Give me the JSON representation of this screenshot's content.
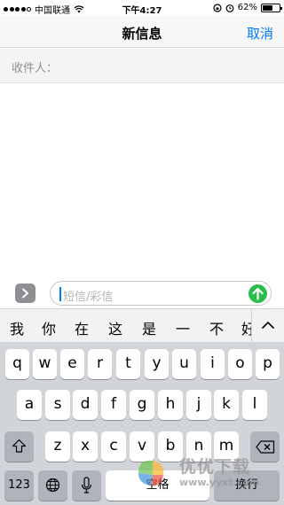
{
  "status_bar": {
    "carrier": "中国联通",
    "time": "下午4:27",
    "battery_percent": "62%",
    "battery_level": 0.62
  },
  "nav": {
    "title": "新信息",
    "cancel_label": "取消"
  },
  "recipient": {
    "label": "收件人："
  },
  "compose": {
    "placeholder": "短信/彩信"
  },
  "candidates": [
    "我",
    "你",
    "在",
    "这",
    "是",
    "一",
    "不",
    "好"
  ],
  "keyboard": {
    "row1": [
      "q",
      "w",
      "e",
      "r",
      "t",
      "y",
      "u",
      "i",
      "o",
      "p"
    ],
    "row2": [
      "a",
      "s",
      "d",
      "f",
      "g",
      "h",
      "j",
      "k",
      "l"
    ],
    "row3": [
      "z",
      "x",
      "c",
      "v",
      "b",
      "n",
      "m"
    ],
    "numbers_label": "123",
    "space_label": "空格",
    "return_label": "换行"
  },
  "watermark": {
    "text": "优优下载",
    "url": "www.yyxt.com"
  },
  "colors": {
    "accent": "#007aff",
    "send": "#2bbd4b",
    "keyboard_bg": "#d1d4d9"
  }
}
